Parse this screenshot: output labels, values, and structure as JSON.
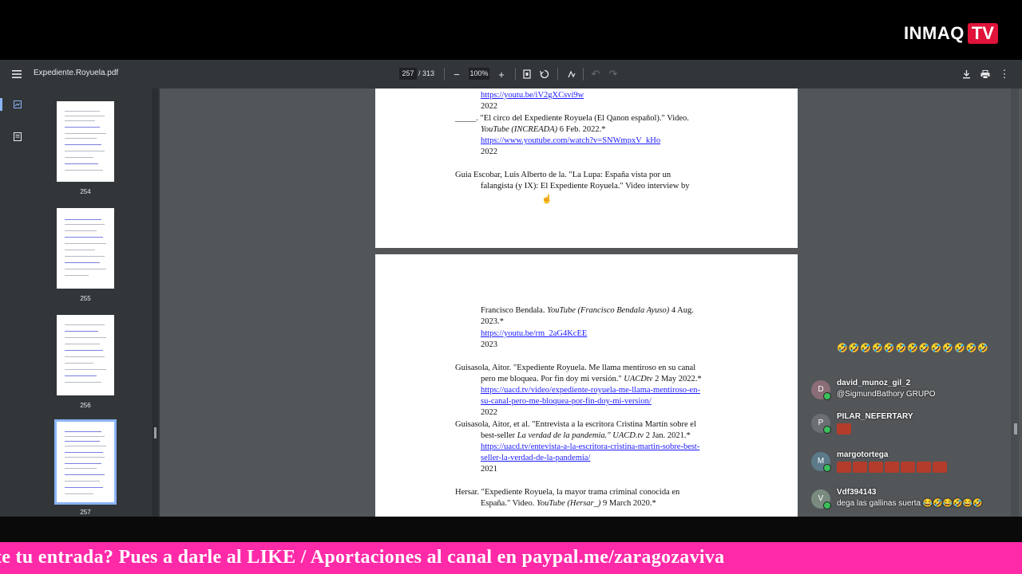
{
  "overlay": {
    "logo_text": "INMAQ",
    "logo_badge": "TV",
    "ticker": "te tu entrada? Pues a darle al LIKE / Aportaciones al canal en paypal.me/zaragozaviva"
  },
  "viewer": {
    "filename": "Expediente.Royuela.pdf",
    "current_page": "257",
    "total_pages": "/ 313",
    "zoom": "100%"
  },
  "thumbnails": [
    {
      "label": "254"
    },
    {
      "label": "255"
    },
    {
      "label": "256"
    },
    {
      "label": "257",
      "selected": true
    }
  ],
  "page_top": {
    "l1": "https://youtu.be/iV2gXCsvi9w",
    "l2": "2022",
    "l3a": "_____. \"El circo del Expediente Royuela (El Qanon español).\" Video.",
    "l4a": "YouTube (INCREADA)",
    "l4b": " 6 Feb. 2022.*",
    "l5": "https://www.youtube.com/watch?v=SNWmpxV_kHo",
    "l6": "2022",
    "l7": "Guia Escobar, Luis Alberto de la. \"La Lupa: España vista por un",
    "l8": "falangista (y IX): El Expediente Royuela.\" Video interview by"
  },
  "page_bottom": {
    "l1a": "Francisco Bendala. ",
    "l1b": "YouTube (Francisco Bendala Ayuso)",
    "l1c": " 4 Aug.",
    "l2": "2023.*",
    "l3": "https://youtu.be/rm_2aG4KcEE",
    "l4": "2023",
    "l5": "Guisasola, Aitor. \"Expediente Royuela. Me llama mentiroso en su canal",
    "l6a": "pero me bloquea. Por fin doy mi versión.\" ",
    "l6b": "UACDtv",
    "l6c": " 2 May 2022.*",
    "l7": "https://uacd.tv/video/expediente-royuela-me-llama-mentiroso-en-",
    "l8": "su-canal-pero-me-bloquea-por-fin-doy-mi-version/",
    "l9": "2022",
    "l10": "Guisasola, Aitor, et al. \"Entrevista a la escritora Cristina Martín sobre el",
    "l11a": "best-seller ",
    "l11b": "La verdad de la pandemia.\" UACD.tv",
    "l11c": " 2 Jan. 2021.*",
    "l12": "https://uacd.tv/entevista-a-la-escritora-cristina-martin-sobre-best-",
    "l13": "seller-la-verdad-de-la-pandemia/",
    "l14": "2021",
    "l15": "Hersar. \"Expediente Royuela, la mayor trama criminal conocida en",
    "l16a": "España.\" Video. ",
    "l16b": "YouTube (Hersar_)",
    "l16c": " 9 March 2020.*"
  },
  "chat": {
    "messages": [
      {
        "user": "david_munoz_gil_2",
        "text": "@SigmundBathory GRUPO",
        "avatar": "D"
      },
      {
        "user": "PILAR_NEFERTARY",
        "text": "",
        "avatar": "P"
      },
      {
        "user": "margotortega",
        "text": "",
        "avatar": "M"
      },
      {
        "user": "Vdf394143",
        "text": "dega las gallinas suerta 😂🤣😂🤣😂🤣",
        "avatar": "V"
      }
    ],
    "emoji_row": "🤣🤣🤣🤣🤣🤣🤣🤣🤣🤣🤣🤣🤣"
  },
  "colors": {
    "toolbar": "#323639",
    "viewer_bg": "#525659",
    "ticker_bg": "#ff2aa8",
    "link": "#1a1aff",
    "logo_badge": "#e0133a"
  }
}
